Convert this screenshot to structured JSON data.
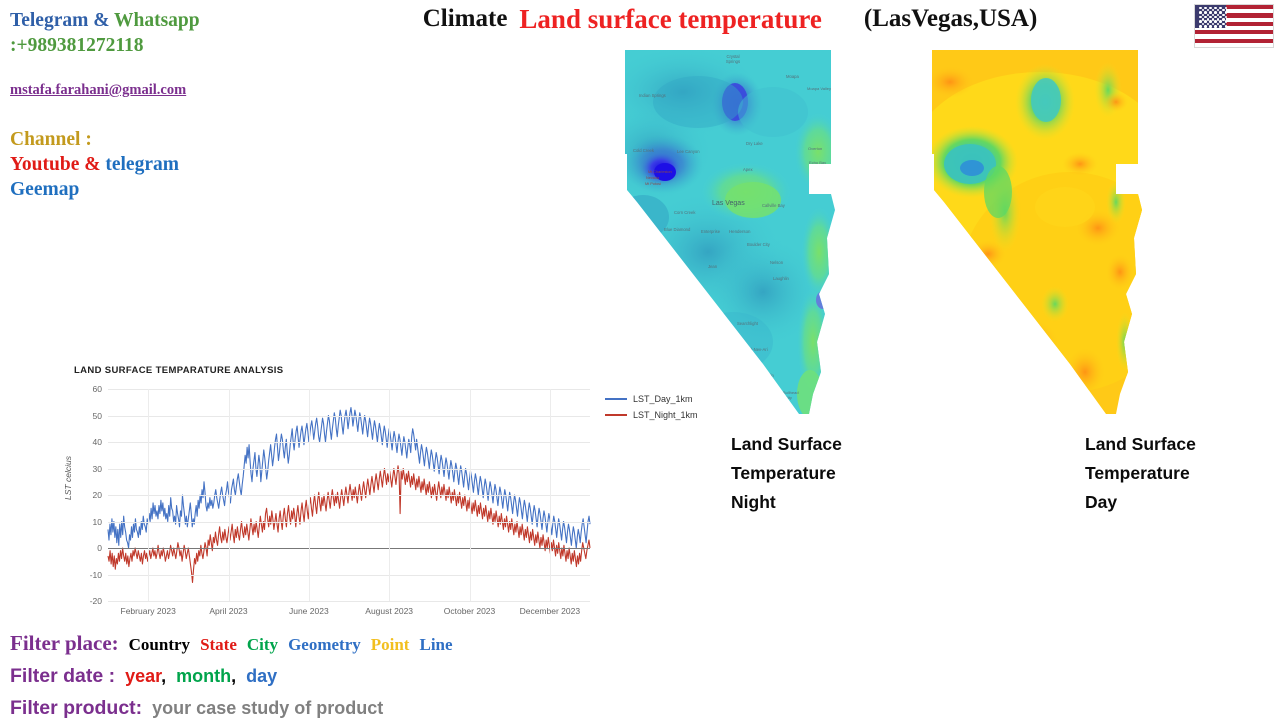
{
  "contact": {
    "line1_a": "Telegram",
    "line1_amp": " & ",
    "line1_b": "Whatsapp",
    "phone": ":+989381272118",
    "email": "mstafa.farahani@gmail.com",
    "channel_label": "Channel :",
    "youtube": "Youtube",
    "amp2": " & ",
    "telegram": "telegram",
    "geemap": "Geemap"
  },
  "header": {
    "climate": "Climate",
    "main_title": "Land  surface temperature",
    "location": "(LasVegas,USA)",
    "flag": "usa-flag"
  },
  "maps": {
    "night": {
      "caption_line1": "Land Surface",
      "caption_line2": "Temperature",
      "caption_line3": "Night",
      "place_labels": [
        "Indian Springs",
        "Cold Creek",
        "Mt Charleston",
        "Nevada",
        "Mt Potosi",
        "Corn Creek",
        "Las Vegas",
        "Henderson",
        "Blue Diamond",
        "Mountain Springs",
        "Goodsprings",
        "Jean",
        "Primm",
        "Searchlight",
        "Cal-Nev-Ari",
        "Laughlin",
        "Nelson",
        "Boulder City",
        "Moapa",
        "Moapa Valley",
        "Overton",
        "Logandale",
        "Dry Lake",
        "Apex",
        "Callville Bay",
        "Crystal Springs"
      ],
      "colors": [
        "#1515e8",
        "#2f6fe0",
        "#37b8c8",
        "#45cfd2",
        "#58dcb8",
        "#6fe07a"
      ]
    },
    "day": {
      "caption_line1": "Land Surface",
      "caption_line2": "Temperature",
      "caption_line3": "Day",
      "colors": [
        "#2f8fd8",
        "#36c2b0",
        "#58d46a",
        "#b8e43a",
        "#f5e21a",
        "#ffc51a",
        "#ff8c1a"
      ]
    }
  },
  "chart_data": {
    "type": "line",
    "title": "LAND SURFACE TEMPARATURE ANALYSIS",
    "xlabel": "",
    "ylabel": "LST celcius",
    "ylim": [
      -20,
      60
    ],
    "yticks": [
      60,
      50,
      40,
      30,
      20,
      10,
      0,
      -10,
      -20
    ],
    "xticks": [
      "February 2023",
      "April 2023",
      "June 2023",
      "August 2023",
      "October 2023",
      "December 2023"
    ],
    "grid": true,
    "legend_position": "right",
    "series": [
      {
        "name": "LST_Day_1km",
        "color": "#4472c4",
        "values": [
          7,
          3,
          9,
          5,
          11,
          6,
          10,
          4,
          8,
          2,
          7,
          1,
          9,
          4,
          10,
          5,
          12,
          8,
          6,
          3,
          2,
          0,
          5,
          3,
          8,
          4,
          9,
          6,
          11,
          7,
          6,
          4,
          8,
          5,
          10,
          7,
          12,
          9,
          8,
          6,
          11,
          9,
          13,
          10,
          15,
          11,
          17,
          13,
          16,
          12,
          14,
          11,
          16,
          13,
          18,
          14,
          17,
          12,
          15,
          11,
          13,
          10,
          16,
          12,
          19,
          15,
          14,
          10,
          12,
          9,
          16,
          13,
          11,
          8,
          14,
          12,
          20,
          16,
          13,
          9,
          12,
          8,
          11,
          14,
          17,
          13,
          8,
          11,
          9,
          13,
          16,
          12,
          18,
          15,
          20,
          17,
          22,
          19,
          25,
          21,
          16,
          14,
          17,
          15,
          19,
          16,
          18,
          15,
          17,
          20,
          22,
          19,
          17,
          15,
          18,
          21,
          23,
          20,
          18,
          16,
          20,
          22,
          25,
          21,
          19,
          17,
          22,
          24,
          26,
          22,
          20,
          23,
          26,
          28,
          25,
          22,
          20,
          24,
          27,
          31,
          35,
          32,
          38,
          34,
          39,
          33,
          28,
          25,
          30,
          33,
          36,
          30,
          27,
          31,
          35,
          32,
          25,
          29,
          33,
          37,
          34,
          30,
          26,
          29,
          33,
          36,
          39,
          35,
          31,
          34,
          38,
          41,
          43,
          38,
          33,
          36,
          40,
          43,
          41,
          37,
          34,
          38,
          41,
          36,
          32,
          35,
          39,
          42,
          45,
          40,
          37,
          41,
          44,
          46,
          42,
          38,
          41,
          44,
          46,
          43,
          39,
          42,
          45,
          47,
          44,
          40,
          43,
          46,
          48,
          45,
          41,
          44,
          47,
          49,
          46,
          42,
          40,
          43,
          46,
          49,
          47,
          43,
          40,
          44,
          47,
          50,
          48,
          44,
          41,
          45,
          48,
          51,
          49,
          45,
          42,
          46,
          49,
          52,
          50,
          46,
          43,
          47,
          50,
          52,
          49,
          45,
          48,
          51,
          53,
          50,
          46,
          49,
          52,
          50,
          47,
          44,
          48,
          51,
          49,
          46,
          43,
          47,
          50,
          48,
          45,
          42,
          46,
          49,
          47,
          44,
          41,
          45,
          48,
          46,
          43,
          40,
          44,
          47,
          45,
          42,
          39,
          43,
          46,
          44,
          41,
          38,
          42,
          45,
          43,
          40,
          37,
          41,
          44,
          42,
          39,
          36,
          40,
          43,
          41,
          38,
          35,
          39,
          42,
          40,
          37,
          34,
          38,
          41,
          39,
          36,
          42,
          45,
          43,
          40,
          37,
          41,
          38,
          35,
          32,
          36,
          39,
          37,
          34,
          31,
          35,
          38,
          36,
          33,
          30,
          34,
          37,
          35,
          32,
          29,
          33,
          36,
          34,
          31,
          28,
          32,
          35,
          33,
          30,
          27,
          31,
          34,
          32,
          29,
          26,
          30,
          33,
          31,
          28,
          25,
          29,
          32,
          30,
          27,
          24,
          28,
          31,
          29,
          26,
          23,
          27,
          30,
          28,
          25,
          22,
          26,
          29,
          27,
          24,
          21,
          25,
          28,
          26,
          23,
          20,
          24,
          27,
          25,
          22,
          19,
          23,
          26,
          24,
          21,
          18,
          22,
          25,
          23,
          20,
          17,
          21,
          24,
          22,
          19,
          16,
          20,
          23,
          21,
          18,
          15,
          19,
          22,
          20,
          17,
          14,
          18,
          21,
          19,
          16,
          13,
          17,
          20,
          18,
          15,
          12,
          16,
          19,
          17,
          14,
          11,
          15,
          18,
          16,
          13,
          10,
          14,
          17,
          15,
          12,
          9,
          13,
          16,
          14,
          11,
          8,
          12,
          15,
          13,
          10,
          7,
          11,
          14,
          12,
          9,
          6,
          10,
          13,
          11,
          8,
          5,
          9,
          12,
          10,
          7,
          4,
          8,
          11,
          9,
          6,
          3,
          7,
          10,
          8,
          5,
          2,
          6,
          9,
          7,
          4,
          1,
          5,
          8,
          6,
          3,
          0,
          4,
          7,
          5,
          2,
          6,
          9,
          11,
          8,
          5,
          2,
          6,
          10,
          12,
          9
        ]
      },
      {
        "name": "LST_Night_1km",
        "color": "#c0392b",
        "values": [
          -3,
          -5,
          -1,
          -6,
          -2,
          -7,
          -3,
          -8,
          -4,
          -6,
          -2,
          -5,
          -1,
          -4,
          0,
          -3,
          -5,
          -2,
          -6,
          -3,
          -7,
          -4,
          -2,
          -5,
          -1,
          -3,
          0,
          -2,
          -4,
          -1,
          -3,
          -5,
          -2,
          -6,
          -3,
          -1,
          -4,
          -2,
          -5,
          -3,
          -1,
          -4,
          -2,
          0,
          -3,
          -1,
          -4,
          -2,
          1,
          -2,
          -4,
          -1,
          -3,
          0,
          -2,
          -5,
          -3,
          -1,
          -4,
          -2,
          1,
          -1,
          -3,
          0,
          -2,
          -4,
          -1,
          2,
          0,
          -3,
          -1,
          -5,
          -2,
          1,
          -1,
          -4,
          -2,
          0,
          -3,
          -6,
          -9,
          -13,
          -8,
          -4,
          -6,
          -2,
          -5,
          -1,
          -3,
          1,
          -2,
          -4,
          -1,
          2,
          0,
          -3,
          3,
          1,
          5,
          2,
          -1,
          4,
          2,
          6,
          3,
          1,
          5,
          8,
          4,
          2,
          6,
          3,
          7,
          4,
          2,
          5,
          8,
          3,
          6,
          9,
          5,
          2,
          7,
          4,
          8,
          5,
          3,
          7,
          10,
          6,
          4,
          8,
          5,
          9,
          6,
          3,
          7,
          11,
          8,
          5,
          9,
          6,
          10,
          7,
          4,
          8,
          12,
          9,
          6,
          10,
          7,
          13,
          15,
          11,
          8,
          12,
          9,
          14,
          11,
          7,
          10,
          13,
          9,
          6,
          11,
          14,
          10,
          7,
          12,
          15,
          11,
          8,
          13,
          16,
          12,
          9,
          14,
          11,
          15,
          12,
          8,
          13,
          16,
          12,
          9,
          14,
          17,
          13,
          10,
          15,
          18,
          14,
          11,
          16,
          19,
          15,
          12,
          17,
          20,
          16,
          13,
          18,
          21,
          17,
          14,
          19,
          16,
          20,
          17,
          14,
          18,
          21,
          18,
          15,
          19,
          22,
          19,
          16,
          20,
          17,
          21,
          18,
          15,
          19,
          22,
          19,
          16,
          20,
          23,
          20,
          17,
          21,
          24,
          21,
          18,
          22,
          19,
          23,
          20,
          17,
          21,
          24,
          21,
          18,
          22,
          25,
          22,
          19,
          23,
          26,
          23,
          20,
          24,
          27,
          24,
          21,
          25,
          28,
          25,
          22,
          26,
          29,
          26,
          23,
          27,
          30,
          27,
          24,
          28,
          25,
          29,
          26,
          23,
          27,
          30,
          27,
          24,
          28,
          31,
          28,
          13,
          29,
          26,
          30,
          27,
          24,
          28,
          25,
          29,
          26,
          23,
          27,
          24,
          28,
          25,
          22,
          26,
          23,
          27,
          24,
          21,
          25,
          22,
          26,
          23,
          20,
          24,
          21,
          25,
          22,
          19,
          23,
          20,
          24,
          21,
          18,
          22,
          25,
          22,
          19,
          23,
          20,
          24,
          21,
          18,
          22,
          19,
          23,
          20,
          17,
          21,
          18,
          22,
          19,
          16,
          20,
          17,
          21,
          18,
          15,
          19,
          16,
          20,
          17,
          14,
          18,
          15,
          19,
          16,
          13,
          17,
          14,
          18,
          15,
          12,
          16,
          13,
          17,
          14,
          11,
          15,
          12,
          16,
          13,
          10,
          14,
          11,
          15,
          12,
          9,
          13,
          10,
          14,
          11,
          8,
          12,
          9,
          13,
          10,
          7,
          11,
          8,
          12,
          9,
          6,
          10,
          7,
          11,
          8,
          5,
          9,
          6,
          10,
          7,
          4,
          8,
          5,
          9,
          6,
          3,
          7,
          4,
          8,
          5,
          2,
          6,
          3,
          7,
          4,
          1,
          5,
          2,
          6,
          3,
          0,
          4,
          1,
          5,
          2,
          -1,
          3,
          0,
          4,
          1,
          -2,
          2,
          -1,
          3,
          0,
          -3,
          1,
          -2,
          2,
          -1,
          -4,
          0,
          -3,
          1,
          -2,
          -5,
          -1,
          -4,
          0,
          -3,
          -6,
          -2,
          -5,
          -1,
          -4,
          -7,
          -3,
          -6,
          -2,
          -5,
          -1,
          2,
          0,
          -2,
          -4,
          -1,
          1,
          3,
          0
        ]
      }
    ]
  },
  "filters": {
    "place_label": "Filter place:",
    "place_options": [
      {
        "label": "Country",
        "color": "#000000"
      },
      {
        "label": "State",
        "color": "#e01b16"
      },
      {
        "label": "City",
        "color": "#00a44b"
      },
      {
        "label": "Geometry",
        "color": "#2f6fc4"
      },
      {
        "label": "Point",
        "color": "#f2bf1f"
      },
      {
        "label": "Line",
        "color": "#2f6fc4"
      }
    ],
    "date_label": "Filter date :",
    "date_options": [
      {
        "label": "year",
        "color": "#e01b16"
      },
      {
        "label": ",",
        "color": "#000000"
      },
      {
        "label": "month",
        "color": "#00a44b"
      },
      {
        "label": ",",
        "color": "#000000"
      },
      {
        "label": "day",
        "color": "#2f6fc4"
      }
    ],
    "product_label": "Filter product:",
    "product_value": "your case study of product"
  }
}
